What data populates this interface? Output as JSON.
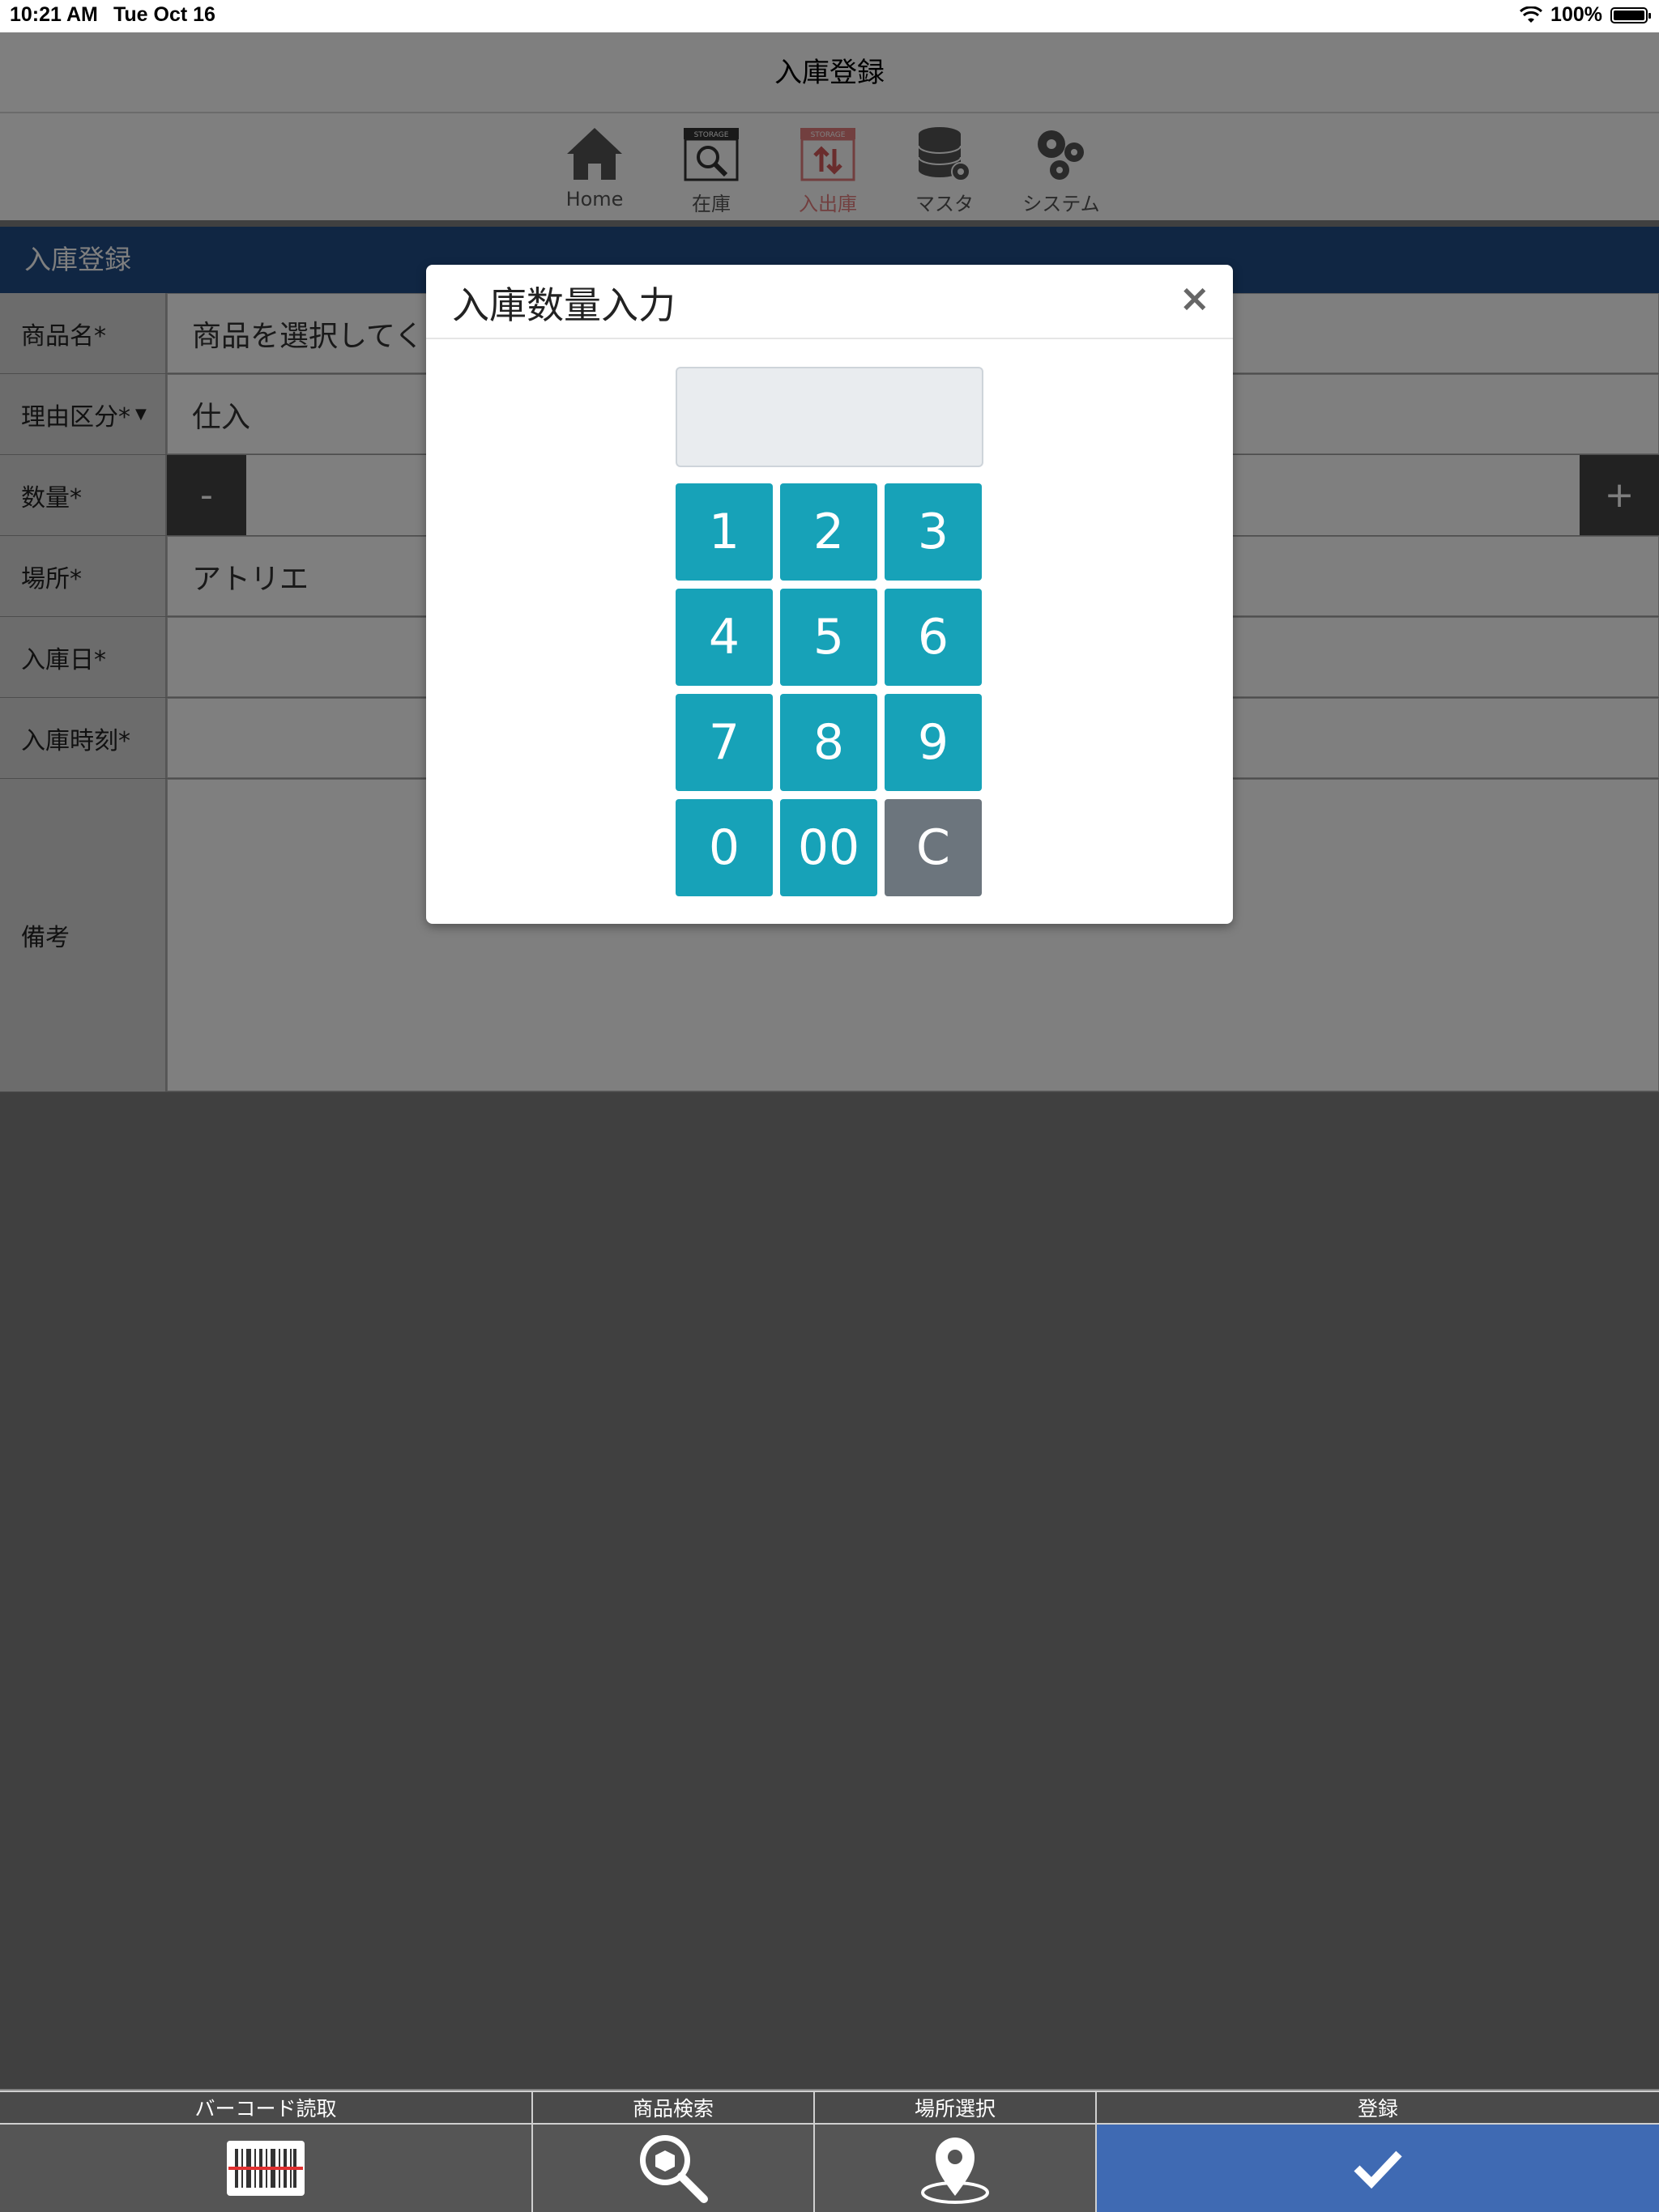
{
  "status_bar": {
    "time": "10:21 AM",
    "date": "Tue Oct 16",
    "battery": "100%",
    "battery_level": 1.0
  },
  "nav": {
    "title": "入庫登録"
  },
  "icon_bar": [
    {
      "label": "Home",
      "icon": "home-icon",
      "active": false
    },
    {
      "label": "在庫",
      "icon": "storage-search-icon",
      "active": false
    },
    {
      "label": "入出庫",
      "icon": "storage-inout-icon",
      "active": true
    },
    {
      "label": "マスタ",
      "icon": "database-gear-icon",
      "active": false
    },
    {
      "label": "システム",
      "icon": "gears-icon",
      "active": false
    }
  ],
  "form": {
    "header": "入庫登録",
    "product_label": "商品名*",
    "product_value": "商品を選択してく",
    "reason_label": "理由区分*",
    "reason_value": "仕入",
    "qty_label": "数量*",
    "qty_minus": "-",
    "qty_plus": "+",
    "location_label": "場所*",
    "location_value": "アトリエ",
    "date_label": "入庫日*",
    "time_label": "入庫時刻*",
    "notes_label": "備考"
  },
  "modal": {
    "title": "入庫数量入力",
    "close": "×",
    "keys": [
      "1",
      "2",
      "3",
      "4",
      "5",
      "6",
      "7",
      "8",
      "9",
      "0",
      "00",
      "C"
    ]
  },
  "bottom_bar": [
    {
      "label": "バーコード読取",
      "icon": "barcode-icon"
    },
    {
      "label": "商品検索",
      "icon": "product-search-icon"
    },
    {
      "label": "場所選択",
      "icon": "location-pin-icon"
    },
    {
      "label": "登録",
      "icon": "checkmark-icon"
    }
  ],
  "colors": {
    "primary": "#204d87",
    "key": "#17a2b8",
    "key_clear": "#6c757d",
    "submit": "#3f6ab3",
    "active_tab": "#e57f7f"
  }
}
